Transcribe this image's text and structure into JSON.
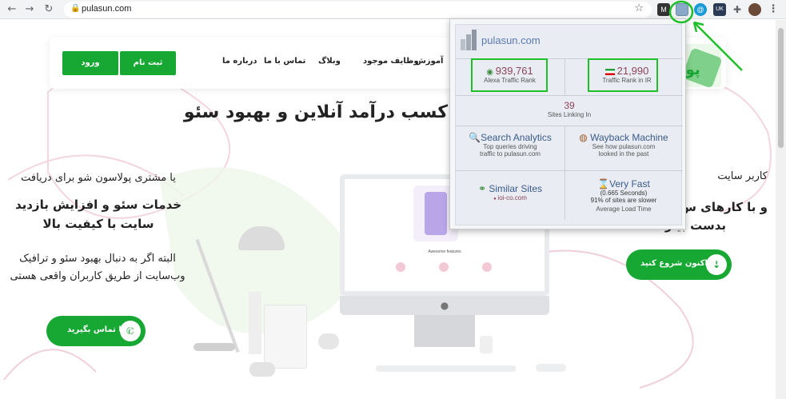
{
  "browser": {
    "back": "←",
    "forward": "→",
    "reload": "↻",
    "url": "pulasun.com",
    "star": "☆",
    "menu": "⋮",
    "extensions": [
      {
        "name": "m-extension",
        "label": "M",
        "color": "#333333"
      },
      {
        "name": "alexa-extension",
        "label": "",
        "color": "#8aa8c8"
      },
      {
        "name": "at-extension",
        "label": "@",
        "color": "#1a9ad6"
      },
      {
        "name": "uk-extension",
        "label": "UK",
        "color": "#2b3a55"
      },
      {
        "name": "puzzle-extension",
        "label": "✚",
        "color": "#5f6368"
      }
    ]
  },
  "site": {
    "buttons": {
      "login": "ورود",
      "signup": "ثبت نام"
    },
    "nav": [
      "آموزش",
      "وظایف موجود",
      "وبلاگ",
      "تماس با ما",
      "درباره ما"
    ],
    "headline": "کسب درآمد آنلاین و بهبود سئو",
    "left": {
      "line1": "یا مشتری پولاسون شو برای دریافت",
      "line2": "خدمات سئو و افزایش بازدید",
      "line3": "سایت با کیفیت بالا",
      "para": "البته اگر به دنبال بهبود سئو و ترافیک وب‌سایت از طریق کاربران واقعی هستی",
      "cta": "با ما تماس بگیرید"
    },
    "right": {
      "line1": "کاربر سایت",
      "line2": "و با کارهای س",
      "line3": "بدست بیار",
      "cta": "هم اکنون شروع کنید"
    },
    "mockup_caption": "Awesome features",
    "logo_text": "پول"
  },
  "popup": {
    "site": "pulasun.com",
    "alexa_rank": "939,761",
    "alexa_label": "Alexa Traffic Rank",
    "country_rank": "21,990",
    "country_label": "Traffic Rank in",
    "country_code": "IR",
    "links": "39",
    "links_label": "Sites Linking In",
    "search_title": "Search Analytics",
    "search_desc1": "Top queries driving",
    "search_desc2": "traffic to pulasun.com",
    "wayback_title": "Wayback Machine",
    "wayback_desc1": "See how pulasun.com",
    "wayback_desc2": "looked in the past",
    "similar_title": "Similar Sites",
    "similar_site": "ioi-co.com",
    "speed_title": "Very Fast",
    "speed_sec": "(0.665 Seconds)",
    "speed_slower": "91% of sites are slower",
    "speed_label": "Average Load Time"
  },
  "colors": {
    "brand_green": "#16a833",
    "highlight_green": "#1fbf2a",
    "rank_color": "#8a4456"
  }
}
